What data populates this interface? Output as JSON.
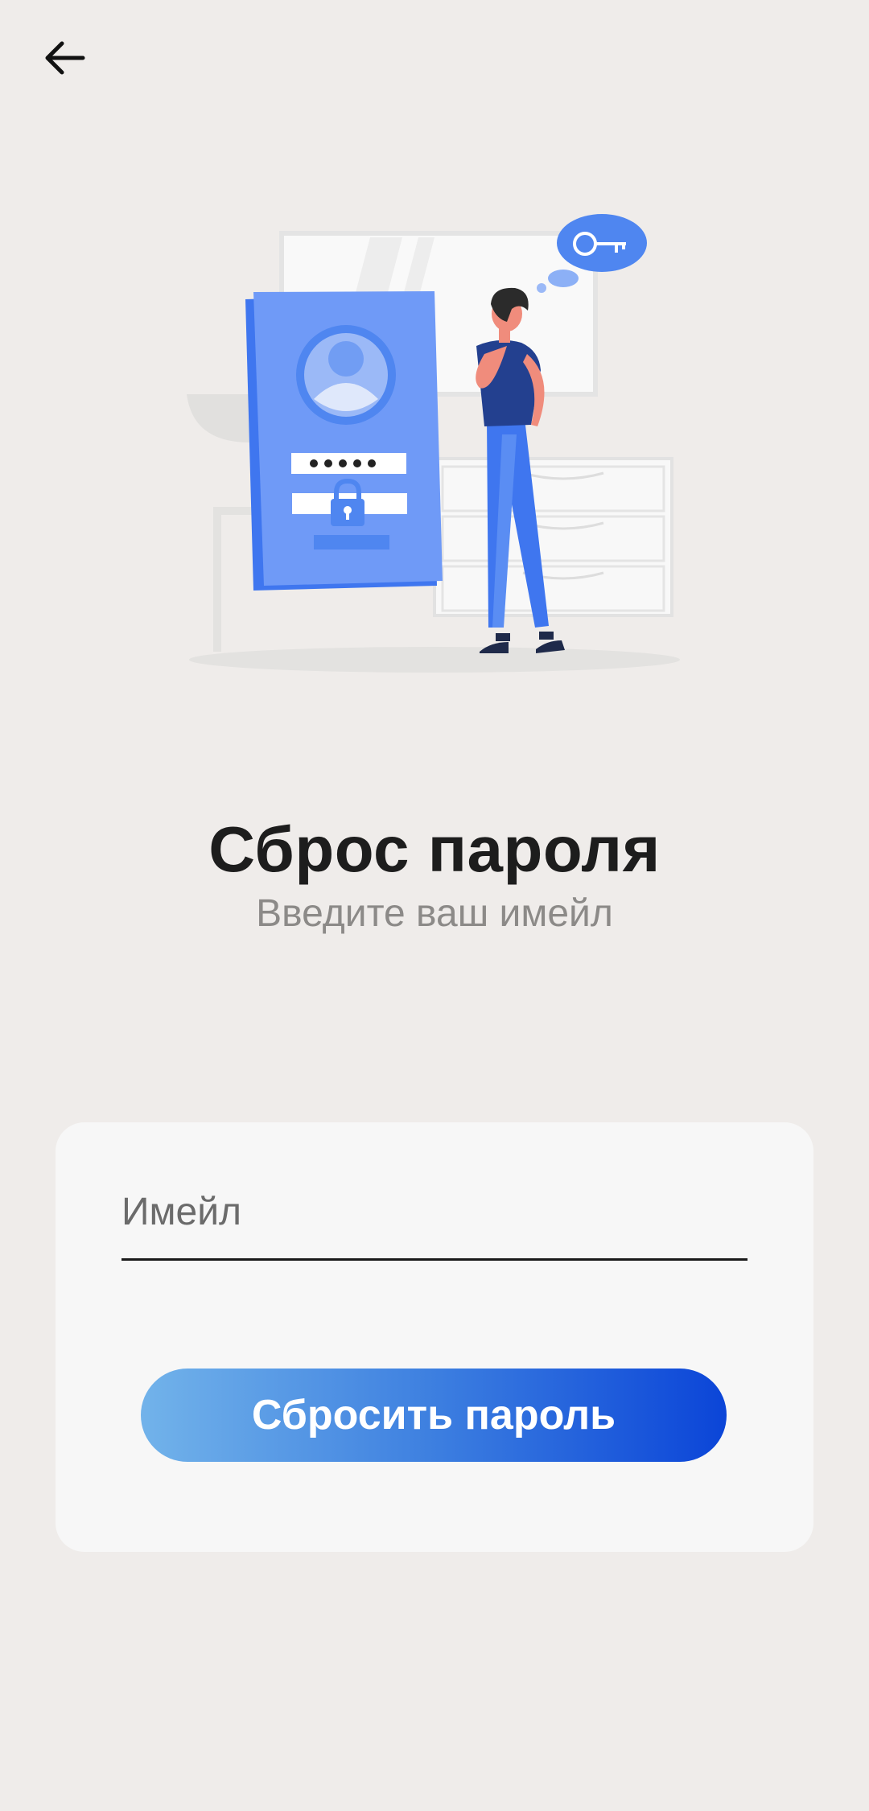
{
  "header": {
    "back_icon": "arrow-left-icon"
  },
  "illustration": {
    "name": "password-reset-illustration"
  },
  "heading": {
    "title": "Сброс пароля",
    "subtitle": "Введите ваш имейл"
  },
  "form": {
    "email_placeholder": "Имейл",
    "email_value": "",
    "submit_label": "Сбросить пароль"
  },
  "colors": {
    "background": "#efecea",
    "card": "#f7f7f7",
    "accent_start": "#72b3ea",
    "accent_end": "#0b45d8",
    "illustration_blue": "#4f86f0"
  }
}
